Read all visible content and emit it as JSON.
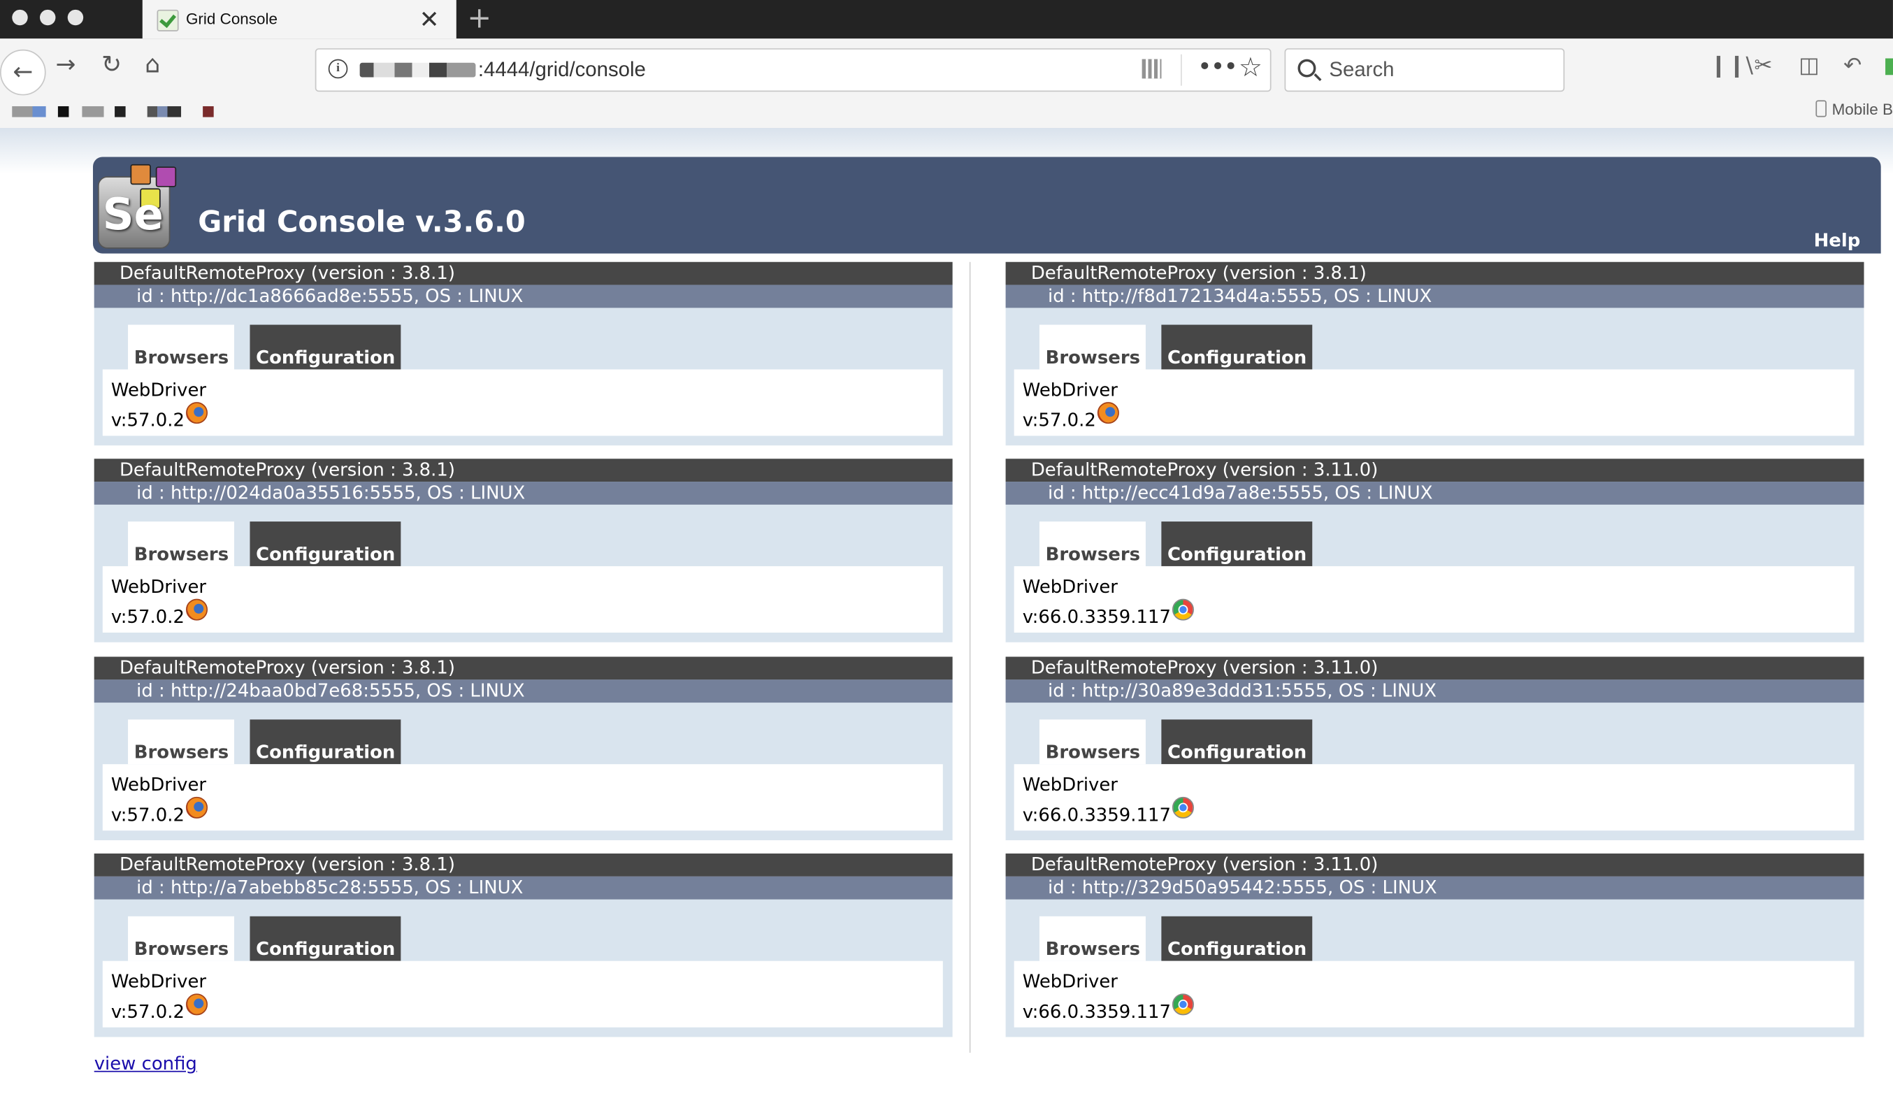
{
  "browser": {
    "tab_title": "Grid Console",
    "tab_close": "✕",
    "new_tab": "+",
    "url": ":4444/grid/console",
    "search_placeholder": "Search",
    "mobile_bookmarks": "Mobile B"
  },
  "header": {
    "logo_text": "Se",
    "title": "Grid Console v.3.6.0",
    "help": "Help"
  },
  "proxies_left": [
    {
      "name": "DefaultRemoteProxy (version : 3.8.1)",
      "id": "id : http://dc1a8666ad8e:5555, OS : LINUX",
      "tab_browsers": "Browsers",
      "tab_config": "Configuration",
      "driver": "WebDriver",
      "version": "v:57.0.2",
      "browser_icon": "firefox-icon"
    },
    {
      "name": "DefaultRemoteProxy (version : 3.8.1)",
      "id": "id : http://024da0a35516:5555, OS : LINUX",
      "tab_browsers": "Browsers",
      "tab_config": "Configuration",
      "driver": "WebDriver",
      "version": "v:57.0.2",
      "browser_icon": "firefox-icon"
    },
    {
      "name": "DefaultRemoteProxy (version : 3.8.1)",
      "id": "id : http://24baa0bd7e68:5555, OS : LINUX",
      "tab_browsers": "Browsers",
      "tab_config": "Configuration",
      "driver": "WebDriver",
      "version": "v:57.0.2",
      "browser_icon": "firefox-icon"
    },
    {
      "name": "DefaultRemoteProxy (version : 3.8.1)",
      "id": "id : http://a7abebb85c28:5555, OS : LINUX",
      "tab_browsers": "Browsers",
      "tab_config": "Configuration",
      "driver": "WebDriver",
      "version": "v:57.0.2",
      "browser_icon": "firefox-icon"
    }
  ],
  "proxies_right": [
    {
      "name": "DefaultRemoteProxy (version : 3.8.1)",
      "id": "id : http://f8d172134d4a:5555, OS : LINUX",
      "tab_browsers": "Browsers",
      "tab_config": "Configuration",
      "driver": "WebDriver",
      "version": "v:57.0.2",
      "browser_icon": "firefox-icon"
    },
    {
      "name": "DefaultRemoteProxy (version : 3.11.0)",
      "id": "id : http://ecc41d9a7a8e:5555, OS : LINUX",
      "tab_browsers": "Browsers",
      "tab_config": "Configuration",
      "driver": "WebDriver",
      "version": "v:66.0.3359.117",
      "browser_icon": "chrome-icon"
    },
    {
      "name": "DefaultRemoteProxy (version : 3.11.0)",
      "id": "id : http://30a89e3ddd31:5555, OS : LINUX",
      "tab_browsers": "Browsers",
      "tab_config": "Configuration",
      "driver": "WebDriver",
      "version": "v:66.0.3359.117",
      "browser_icon": "chrome-icon"
    },
    {
      "name": "DefaultRemoteProxy (version : 3.11.0)",
      "id": "id : http://329d50a95442:5555, OS : LINUX",
      "tab_browsers": "Browsers",
      "tab_config": "Configuration",
      "driver": "WebDriver",
      "version": "v:66.0.3359.117",
      "browser_icon": "chrome-icon"
    }
  ],
  "footer": {
    "view_config": "view config"
  },
  "colors": {
    "header_bg": "#455574",
    "proxy_bg": "#d9e4ee",
    "proxy_title_bg": "#474747",
    "proxy_id_bg": "#74809a",
    "link": "#1a0dab"
  }
}
